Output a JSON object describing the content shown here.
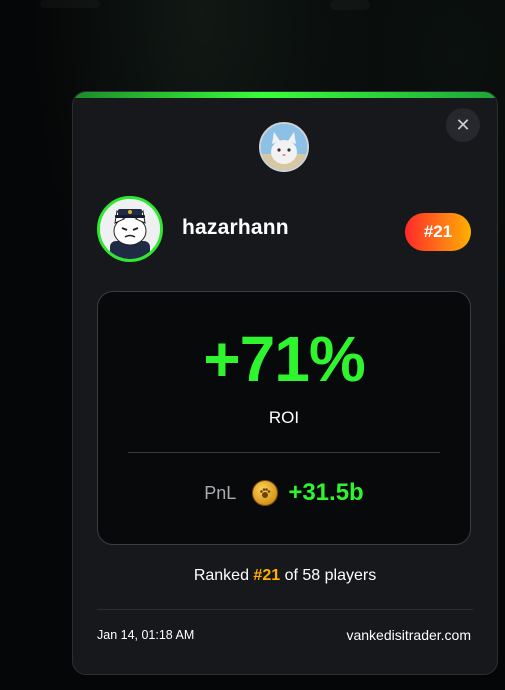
{
  "close_icon": "close-icon",
  "profile": {
    "username": "hazarhann",
    "rank_badge": "#21"
  },
  "stats": {
    "roi_value": "+71%",
    "roi_label": "ROI",
    "pnl_label": "PnL",
    "pnl_value": "+31.5b",
    "coin_icon": "coin-icon"
  },
  "ranking": {
    "prefix": "Ranked",
    "rank": "#21",
    "suffix": "of 58 players"
  },
  "footer": {
    "date": "Jan 14, 01:18 AM",
    "site": "vankedisitrader.com"
  },
  "colors": {
    "accent_green": "#2ef52e",
    "rank_orange": "#ffb000",
    "card_bg": "#17181c"
  }
}
